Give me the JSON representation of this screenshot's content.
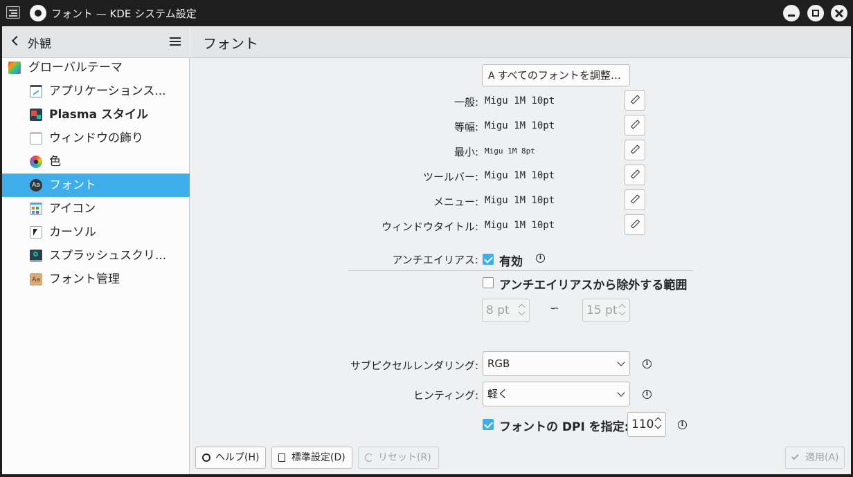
{
  "window": {
    "title": "フォント — KDE システム設定",
    "icons": [
      "menu-icon",
      "app-icon",
      "minimize-icon",
      "maximize-icon",
      "close-icon"
    ]
  },
  "sidebar": {
    "title": "外観",
    "items": [
      {
        "label": "グローバルテーマ",
        "icon": "global-theme-icon",
        "level": 0,
        "active": false
      },
      {
        "label": "アプリケーションス...",
        "icon": "application-style-icon",
        "level": 1,
        "active": false
      },
      {
        "label": "Plasma スタイル",
        "icon": "plasma-style-icon",
        "level": 1,
        "active": false
      },
      {
        "label": "ウィンドウの飾り",
        "icon": "window-decoration-icon",
        "level": 1,
        "active": false
      },
      {
        "label": "色",
        "icon": "color-icon",
        "level": 1,
        "active": false
      },
      {
        "label": "フォント",
        "icon": "font-icon",
        "level": 1,
        "active": true
      },
      {
        "label": "アイコン",
        "icon": "icons-icon",
        "level": 1,
        "active": false
      },
      {
        "label": "カーソル",
        "icon": "cursor-icon",
        "level": 1,
        "active": false
      },
      {
        "label": "スプラッシュスクリ...",
        "icon": "splash-screen-icon",
        "level": 1,
        "active": false
      },
      {
        "label": "フォント管理",
        "icon": "font-management-icon",
        "level": 1,
        "active": false
      }
    ]
  },
  "main": {
    "title": "フォント",
    "adjust_all_label": "すべてのフォントを調整…",
    "adjust_all_icon_glyph": "A",
    "fonts": [
      {
        "label": "一般:",
        "value": "Migu 1M 10pt"
      },
      {
        "label": "等幅:",
        "value": "Migu 1M 10pt"
      },
      {
        "label": "最小:",
        "value": "Migu 1M 8pt"
      },
      {
        "label": "ツールバー:",
        "value": "Migu 1M 10pt"
      },
      {
        "label": "メニュー:",
        "value": "Migu 1M 10pt"
      },
      {
        "label": "ウィンドウタイトル:",
        "value": "Migu 1M 10pt"
      }
    ],
    "antialias": {
      "label": "アンチエイリアス:",
      "checkbox_label": "有効",
      "checked": true
    },
    "exclude": {
      "label": "アンチエイリアスから除外する範囲",
      "checked": false,
      "from": "8 pt",
      "to": "15 pt",
      "separator": "∽"
    },
    "subpixel": {
      "label": "サブピクセルレンダリング:",
      "value": "RGB"
    },
    "hinting": {
      "label": "ヒンティング:",
      "value": "軽く"
    },
    "dpi": {
      "label": "フォントの DPI を指定:",
      "checked": true,
      "value": "110"
    },
    "info_glyph": "i"
  },
  "footer": {
    "help": "ヘルプ(H)",
    "defaults": "標準設定(D)",
    "reset": "リセット(R)",
    "apply": "適用(A)"
  },
  "colors": {
    "accent": "#3daee9",
    "window_bg": "#eff0f1",
    "titlebar": "#1f1f1f",
    "text": "#232629"
  }
}
